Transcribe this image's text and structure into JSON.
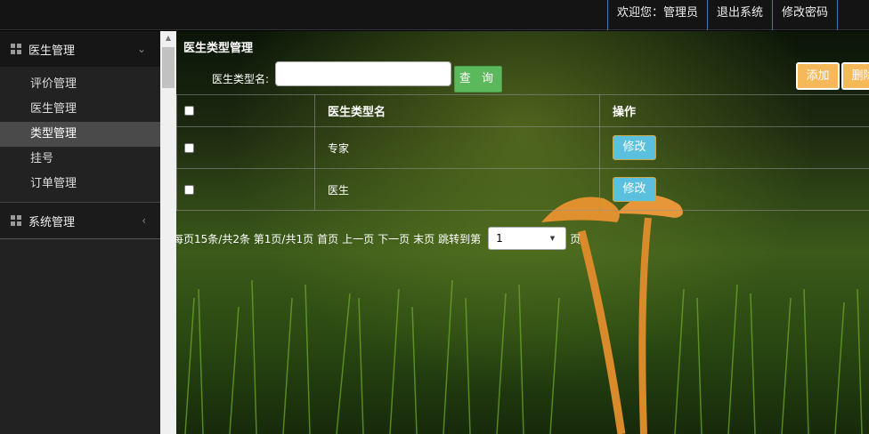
{
  "header": {
    "welcome": "欢迎您：管理员",
    "logout": "退出系统",
    "change_password": "修改密码"
  },
  "sidebar": {
    "groups": [
      {
        "title": "医生管理",
        "icon": "grid-icon",
        "expanded": true,
        "items": [
          {
            "label": "评价管理"
          },
          {
            "label": "医生管理"
          },
          {
            "label": "类型管理",
            "active": true
          },
          {
            "label": "挂号"
          },
          {
            "label": "订单管理"
          }
        ]
      },
      {
        "title": "系统管理",
        "icon": "grid-icon",
        "expanded": false
      }
    ]
  },
  "main": {
    "title": "医生类型管理",
    "search": {
      "label": "医生类型名:",
      "value": "",
      "button": "查 询"
    },
    "actions": {
      "add": "添加",
      "delete": "删除"
    },
    "table": {
      "columns": [
        "",
        "医生类型名",
        "操作"
      ],
      "rows": [
        {
          "name": "专家",
          "action": "修改"
        },
        {
          "name": "医生",
          "action": "修改"
        }
      ]
    },
    "pager": {
      "summary": "每页15条/共2条 第1页/共1页",
      "first": "首页",
      "prev": "上一页",
      "next": "下一页",
      "last": "末页",
      "jump_label": "跳转到第",
      "selected_page": "1",
      "page_suffix": "页"
    }
  },
  "colors": {
    "search_button": "#5cb85c",
    "edit_button": "#5bc0de",
    "add_button": "#f5b95a",
    "sidebar_active": "#4a4a4a"
  }
}
